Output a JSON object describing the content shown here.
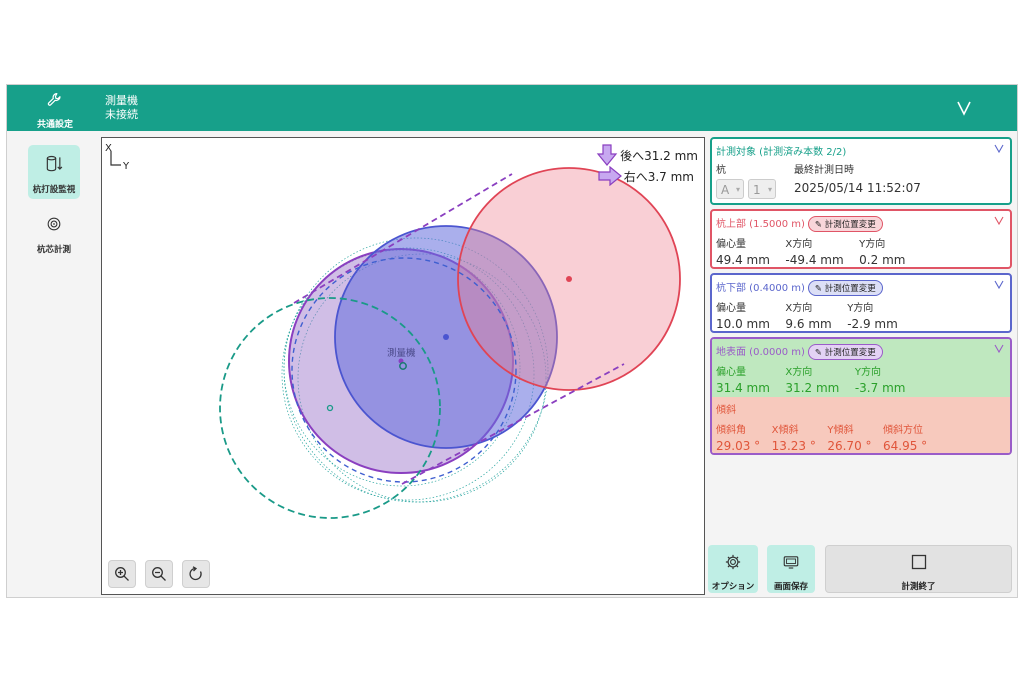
{
  "header": {
    "settings_label": "共通設定",
    "device_name": "測量機",
    "device_status": "未接続",
    "chevron": "V"
  },
  "sidebar": {
    "items": [
      {
        "label": "杭打設監視",
        "icon": "pile-monitor-icon",
        "active": true
      },
      {
        "label": "杭芯計測",
        "icon": "target-icon",
        "active": false
      }
    ]
  },
  "canvas": {
    "axis_x": "X",
    "axis_y": "Y",
    "instrument_label": "測量機",
    "move_back": "後へ31.2 mm",
    "move_right": "右へ3.7 mm"
  },
  "target_panel": {
    "title": "計測対象 (計測済み本数 2/2)",
    "pile_label": "杭",
    "last_measure_label": "最終計測日時",
    "pile_select_1": "A",
    "pile_select_2": "1",
    "last_measure_value": "2025/05/14 11:52:07",
    "chevron": "V",
    "color": "#17a08a"
  },
  "top_panel": {
    "title": "杭上部 (1.5000 m)",
    "tag": "計測位置変更",
    "headers": [
      "偏心量",
      "X方向",
      "Y方向"
    ],
    "values": [
      "49.4 mm",
      "-49.4 mm",
      "0.2 mm"
    ],
    "chevron": "V",
    "color": "#e05566"
  },
  "bottom_panel": {
    "title": "杭下部 (0.4000 m)",
    "tag": "計測位置変更",
    "headers": [
      "偏心量",
      "X方向",
      "Y方向"
    ],
    "values": [
      "10.0 mm",
      "9.6 mm",
      "-2.9 mm"
    ],
    "chevron": "V",
    "color": "#5b66cc"
  },
  "ground_panel": {
    "title": "地表面 (0.0000 m)",
    "tag": "計測位置変更",
    "headers": [
      "偏心量",
      "X方向",
      "Y方向"
    ],
    "values": [
      "31.4 mm",
      "31.2 mm",
      "-3.7 mm"
    ],
    "chevron": "V",
    "color": "#9a5cc8",
    "tilt_title": "傾斜",
    "tilt_headers": [
      "傾斜角",
      "X傾斜",
      "Y傾斜",
      "傾斜方位"
    ],
    "tilt_values": [
      "29.03 °",
      "13.23 °",
      "26.70 °",
      "64.95 °"
    ]
  },
  "bottom_buttons": {
    "options_label": "オプション",
    "save_label": "画面保存",
    "end_label": "計測終了"
  }
}
